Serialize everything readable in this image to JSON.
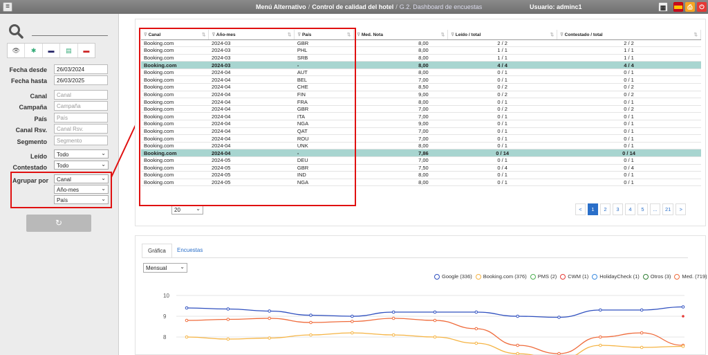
{
  "topbar": {
    "menu_alt": "Menú Alternativo",
    "crumb1": "Control de calidad del hotel",
    "crumb2": "G.2. Dashboard de encuestas",
    "user": "Usuario: adminc1"
  },
  "sidebar": {
    "fecha_desde_label": "Fecha desde",
    "fecha_desde": "26/03/2024",
    "fecha_hasta_label": "Fecha hasta",
    "fecha_hasta": "26/03/2025",
    "canal_label": "Canal",
    "canal_ph": "Canal",
    "campana_label": "Campaña",
    "campana_ph": "Campaña",
    "pais_label": "País",
    "pais_ph": "País",
    "canalrsv_label": "Canal Rsv.",
    "canalrsv_ph": "Canal Rsv.",
    "segmento_label": "Segmento",
    "segmento_ph": "Segmento",
    "leido_label": "Leído",
    "leido_val": "Todo",
    "contestado_label": "Contestado",
    "contestado_val": "Todo",
    "agrupar_label": "Agrupar por",
    "agrupar1": "Canal",
    "agrupar2": "Año-mes",
    "agrupar3": "País"
  },
  "table": {
    "headers": [
      "Canal",
      "Año-mes",
      "País",
      "Med. Nota",
      "Leído / total",
      "Contestado / total"
    ],
    "rows": [
      [
        "Booking.com",
        "2024-03",
        "GBR",
        "8,00",
        "2 / 2",
        "2 / 2",
        false
      ],
      [
        "Booking.com",
        "2024-03",
        "PHL",
        "8,00",
        "1 / 1",
        "1 / 1",
        false
      ],
      [
        "Booking.com",
        "2024-03",
        "SRB",
        "8,00",
        "1 / 1",
        "1 / 1",
        false
      ],
      [
        "Booking.com",
        "2024-03",
        "-",
        "8,00",
        "4 / 4",
        "4 / 4",
        true
      ],
      [
        "Booking.com",
        "2024-04",
        "AUT",
        "8,00",
        "0 / 1",
        "0 / 1",
        false
      ],
      [
        "Booking.com",
        "2024-04",
        "BEL",
        "7,00",
        "0 / 1",
        "0 / 1",
        false
      ],
      [
        "Booking.com",
        "2024-04",
        "CHE",
        "8,50",
        "0 / 2",
        "0 / 2",
        false
      ],
      [
        "Booking.com",
        "2024-04",
        "FIN",
        "9,00",
        "0 / 2",
        "0 / 2",
        false
      ],
      [
        "Booking.com",
        "2024-04",
        "FRA",
        "8,00",
        "0 / 1",
        "0 / 1",
        false
      ],
      [
        "Booking.com",
        "2024-04",
        "GBR",
        "7,00",
        "0 / 2",
        "0 / 2",
        false
      ],
      [
        "Booking.com",
        "2024-04",
        "ITA",
        "7,00",
        "0 / 1",
        "0 / 1",
        false
      ],
      [
        "Booking.com",
        "2024-04",
        "NGA",
        "9,00",
        "0 / 1",
        "0 / 1",
        false
      ],
      [
        "Booking.com",
        "2024-04",
        "QAT",
        "7,00",
        "0 / 1",
        "0 / 1",
        false
      ],
      [
        "Booking.com",
        "2024-04",
        "ROU",
        "7,00",
        "0 / 1",
        "0 / 1",
        false
      ],
      [
        "Booking.com",
        "2024-04",
        "UNK",
        "8,00",
        "0 / 1",
        "0 / 1",
        false
      ],
      [
        "Booking.com",
        "2024-04",
        "-",
        "7,86",
        "0 / 14",
        "0 / 14",
        true
      ],
      [
        "Booking.com",
        "2024-05",
        "DEU",
        "7,00",
        "0 / 1",
        "0 / 1",
        false
      ],
      [
        "Booking.com",
        "2024-05",
        "GBR",
        "7,50",
        "0 / 4",
        "0 / 4",
        false
      ],
      [
        "Booking.com",
        "2024-05",
        "IND",
        "8,00",
        "0 / 1",
        "0 / 1",
        false
      ],
      [
        "Booking.com",
        "2024-05",
        "NGA",
        "8,00",
        "0 / 1",
        "0 / 1",
        false
      ]
    ],
    "page_size": "20",
    "pager": [
      "<",
      "1",
      "2",
      "3",
      "4",
      "5",
      "...",
      "21",
      ">"
    ],
    "pager_active": "1"
  },
  "tabs": {
    "grafica": "Gráfica",
    "encuestas": "Encuestas"
  },
  "period": "Mensual",
  "legend": [
    {
      "label": "Google (336)",
      "color": "#2e4fbf"
    },
    {
      "label": "Booking.com (376)",
      "color": "#f5b342"
    },
    {
      "label": "PMS (2)",
      "color": "#4caf50"
    },
    {
      "label": "CWM (1)",
      "color": "#e53935"
    },
    {
      "label": "HolidayCheck (1)",
      "color": "#3a8be0"
    },
    {
      "label": "Otros (3)",
      "color": "#2e7d32"
    },
    {
      "label": "Med. (719)",
      "color": "#ef6a3a"
    }
  ],
  "chart_data": {
    "type": "line",
    "y_ticks": [
      10,
      9,
      8
    ],
    "series": [
      {
        "name": "Google (336)",
        "color": "#2e4fbf",
        "values": [
          9.4,
          9.35,
          9.25,
          9.05,
          9.0,
          9.2,
          9.2,
          9.2,
          9.0,
          8.95,
          9.3,
          9.3,
          9.45
        ]
      },
      {
        "name": "Med. (719)",
        "color": "#ef6a3a",
        "values": [
          8.8,
          8.85,
          8.9,
          8.7,
          8.75,
          8.9,
          8.8,
          8.4,
          7.6,
          7.2,
          8.0,
          8.2,
          7.6
        ]
      },
      {
        "name": "Booking.com (376)",
        "color": "#f5b342",
        "values": [
          8.0,
          7.9,
          7.95,
          8.1,
          8.2,
          8.1,
          8.0,
          7.7,
          7.2,
          6.9,
          7.6,
          7.5,
          7.55
        ]
      }
    ],
    "extra_points": [
      {
        "series": "CWM (1)",
        "index": 12,
        "value": 9.0,
        "color": "#e53935"
      }
    ]
  }
}
